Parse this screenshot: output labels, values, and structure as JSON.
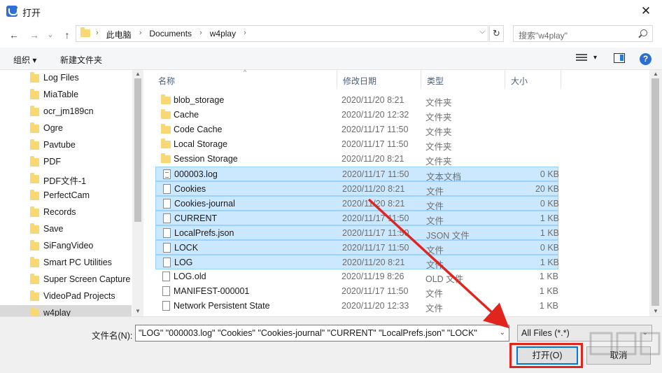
{
  "window": {
    "title": "打开",
    "close_glyph": "✕"
  },
  "nav": {
    "back_glyph": "←",
    "forward_glyph": "→",
    "recent_glyph": "⌄",
    "up_glyph": "↑",
    "breadcrumbs": [
      "此电脑",
      "Documents",
      "w4play"
    ],
    "crumb_separator": "›",
    "refresh_glyph": "↻",
    "search_placeholder": "搜索\"w4play\""
  },
  "toolbar": {
    "organize_label": "组织 ▾",
    "new_folder_label": "新建文件夹",
    "help_glyph": "?"
  },
  "sidebar": {
    "items": [
      {
        "label": "Log Files"
      },
      {
        "label": "MiaTable"
      },
      {
        "label": "ocr_jm189cn"
      },
      {
        "label": "Ogre"
      },
      {
        "label": "Pavtube"
      },
      {
        "label": "PDF"
      },
      {
        "label": "PDF文件-1"
      },
      {
        "label": "PerfectCam"
      },
      {
        "label": "Records"
      },
      {
        "label": "Save"
      },
      {
        "label": "SiFangVideo"
      },
      {
        "label": "Smart PC Utilities"
      },
      {
        "label": "Super Screen Capture"
      },
      {
        "label": "VideoPad Projects"
      },
      {
        "label": "w4play"
      }
    ]
  },
  "columns": {
    "name": "名称",
    "modified": "修改日期",
    "type": "类型",
    "size": "大小"
  },
  "files": [
    {
      "name": "blob_storage",
      "modified": "2020/11/20 8:21",
      "type": "文件夹",
      "size": "",
      "kind": "folder",
      "selected": false
    },
    {
      "name": "Cache",
      "modified": "2020/11/20 12:32",
      "type": "文件夹",
      "size": "",
      "kind": "folder",
      "selected": false
    },
    {
      "name": "Code Cache",
      "modified": "2020/11/17 11:50",
      "type": "文件夹",
      "size": "",
      "kind": "folder",
      "selected": false
    },
    {
      "name": "Local Storage",
      "modified": "2020/11/17 11:50",
      "type": "文件夹",
      "size": "",
      "kind": "folder",
      "selected": false
    },
    {
      "name": "Session Storage",
      "modified": "2020/11/20 8:21",
      "type": "文件夹",
      "size": "",
      "kind": "folder",
      "selected": false
    },
    {
      "name": "000003.log",
      "modified": "2020/11/17 11:50",
      "type": "文本文档",
      "size": "0 KB",
      "kind": "text",
      "selected": true
    },
    {
      "name": "Cookies",
      "modified": "2020/11/20 8:21",
      "type": "文件",
      "size": "20 KB",
      "kind": "file",
      "selected": true
    },
    {
      "name": "Cookies-journal",
      "modified": "2020/11/20 8:21",
      "type": "文件",
      "size": "0 KB",
      "kind": "file",
      "selected": true
    },
    {
      "name": "CURRENT",
      "modified": "2020/11/17 11:50",
      "type": "文件",
      "size": "1 KB",
      "kind": "file",
      "selected": true
    },
    {
      "name": "LocalPrefs.json",
      "modified": "2020/11/17 11:50",
      "type": "JSON 文件",
      "size": "1 KB",
      "kind": "file",
      "selected": true
    },
    {
      "name": "LOCK",
      "modified": "2020/11/17 11:50",
      "type": "文件",
      "size": "0 KB",
      "kind": "file",
      "selected": true
    },
    {
      "name": "LOG",
      "modified": "2020/11/20 8:21",
      "type": "文件",
      "size": "1 KB",
      "kind": "file",
      "selected": true
    },
    {
      "name": "LOG.old",
      "modified": "2020/11/19 8:26",
      "type": "OLD 文件",
      "size": "1 KB",
      "kind": "file",
      "selected": false
    },
    {
      "name": "MANIFEST-000001",
      "modified": "2020/11/17 11:50",
      "type": "文件",
      "size": "1 KB",
      "kind": "file",
      "selected": false
    },
    {
      "name": "Network Persistent State",
      "modified": "2020/11/20 12:33",
      "type": "文件",
      "size": "1 KB",
      "kind": "file",
      "selected": false
    }
  ],
  "bottom": {
    "filename_label": "文件名(N):",
    "filename_value": "\"LOG\" \"000003.log\" \"Cookies\" \"Cookies-journal\" \"CURRENT\" \"LocalPrefs.json\" \"LOCK\"",
    "filter_value": "All Files (*.*)",
    "open_label": "打开(O)",
    "cancel_label": "取消"
  },
  "colors": {
    "selection": "#cce8ff",
    "selection_border": "#99d1ff",
    "annotation_red": "#e0251f"
  }
}
